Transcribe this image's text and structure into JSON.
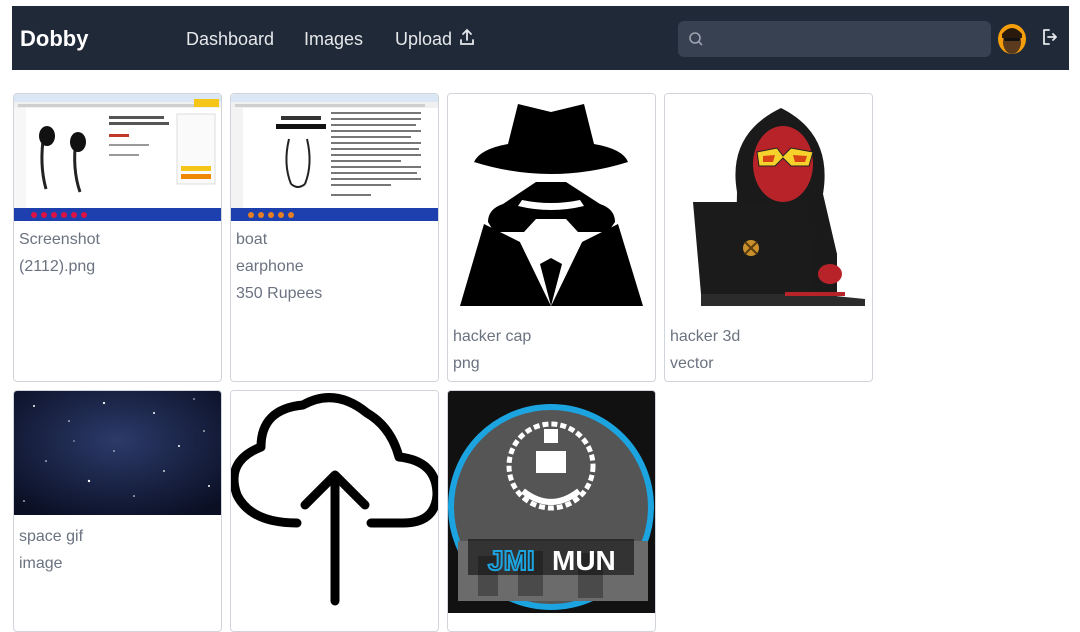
{
  "app": {
    "brand": "Dobby"
  },
  "nav": {
    "links": [
      "Dashboard",
      "Images",
      "Upload"
    ],
    "search_placeholder": "",
    "icons": {
      "upload": "upload-icon",
      "search": "search-icon",
      "logout": "logout-icon",
      "avatar": "avatar"
    }
  },
  "cards": [
    {
      "lines": [
        "Screenshot",
        "(2112).png"
      ]
    },
    {
      "lines": [
        "boat",
        "earphone",
        "350 Rupees"
      ]
    },
    {
      "lines": [
        "hacker cap",
        "png"
      ]
    },
    {
      "lines": [
        "hacker 3d",
        "vector"
      ]
    },
    {
      "lines": [
        "space gif",
        "image"
      ]
    },
    {
      "lines": []
    },
    {
      "lines": []
    }
  ],
  "logo_text": {
    "jmi": "JMI",
    "mun": "MUN"
  },
  "colors": {
    "navbar": "#1f2937",
    "search": "#374151",
    "caption": "#6b7280",
    "jmi_ring": "#1ca4e0"
  }
}
